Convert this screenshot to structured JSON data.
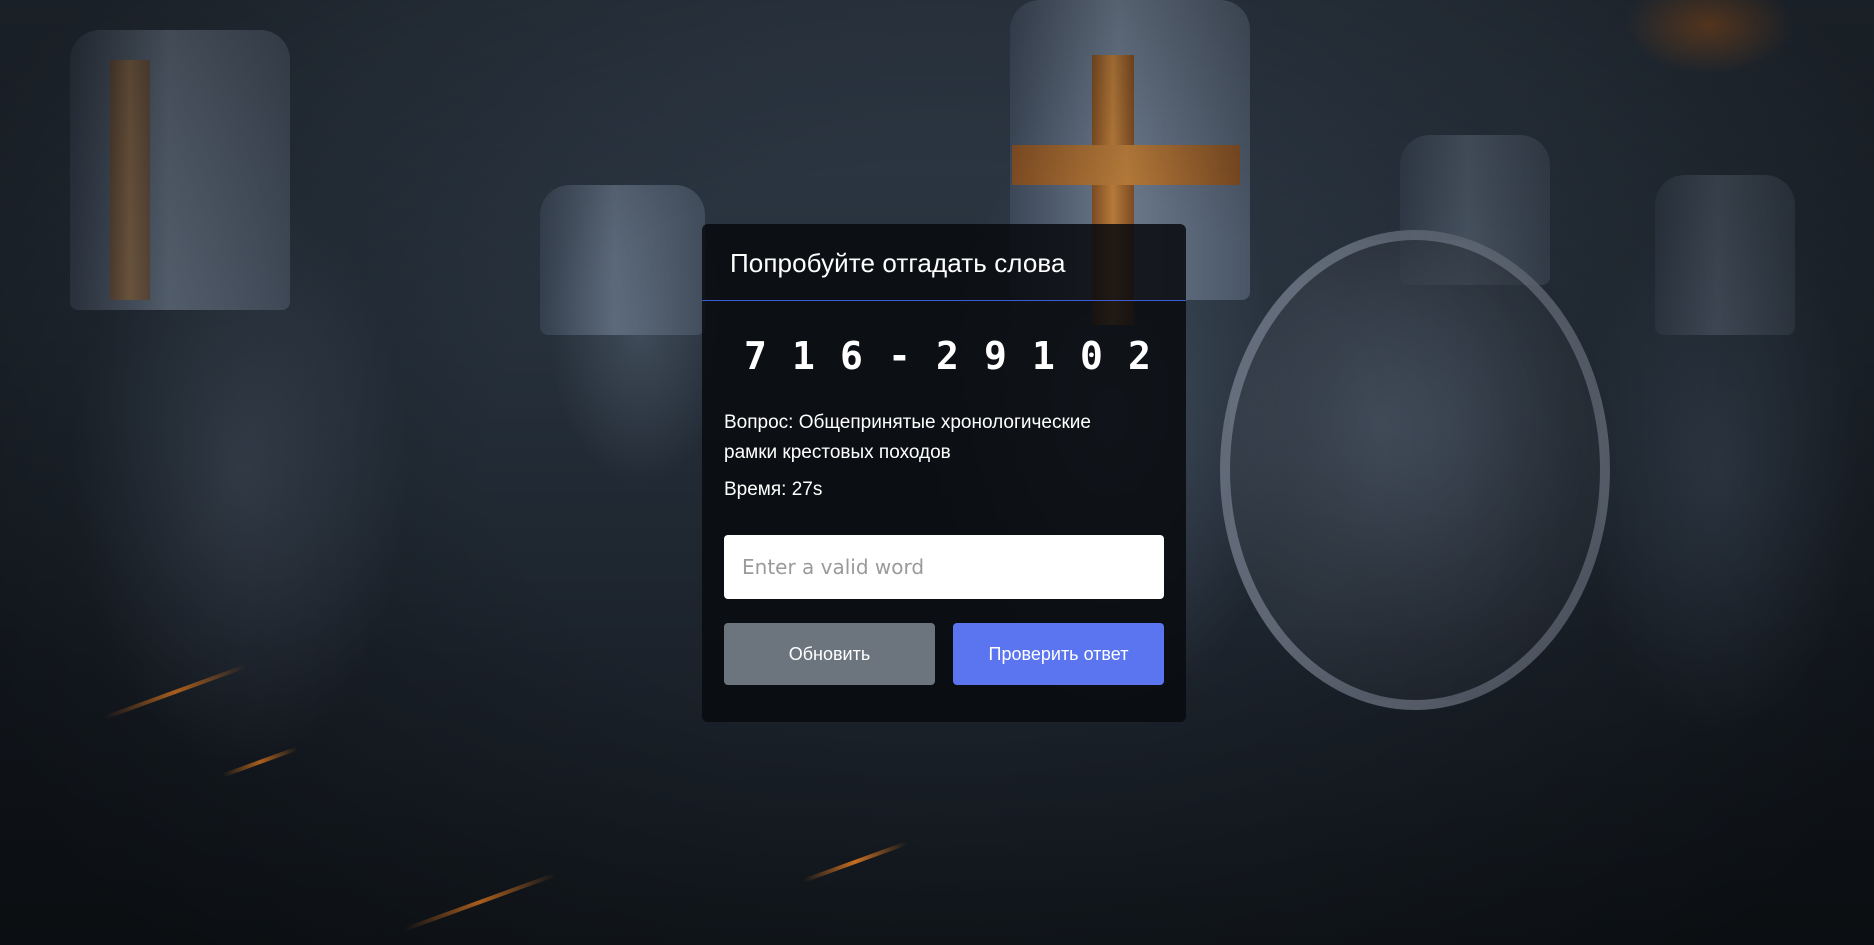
{
  "card": {
    "title": "Попробуйте отгадать слова",
    "code_chars": [
      "7",
      "1",
      "6",
      "-",
      "2",
      "9",
      "1",
      "0",
      "2"
    ],
    "question": "Вопрос: Общепринятые хронологические рамки крестовых походов",
    "timer": "Время: 27s",
    "input_placeholder": "Enter a valid word",
    "refresh_label": "Обновить",
    "check_label": "Проверить ответ"
  },
  "colors": {
    "accent": "#5a75ef",
    "secondary": "#6c757d",
    "divider": "#3d5bd6"
  }
}
